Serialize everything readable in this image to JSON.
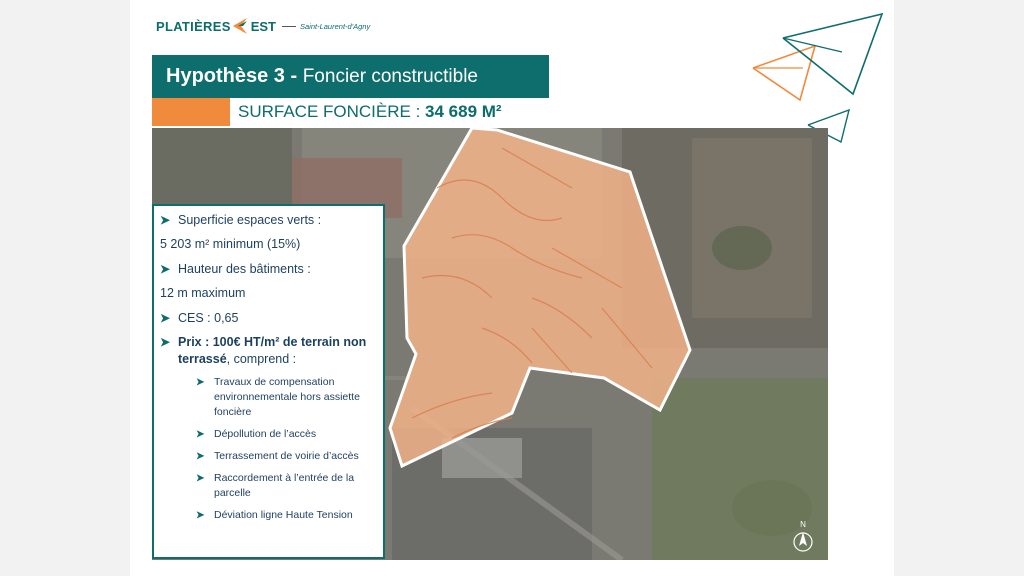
{
  "logo": {
    "brand": "PLATIÈRES",
    "brand_est": "EST",
    "location": "Saint-Laurent-d'Agny"
  },
  "header": {
    "title_strong": "Hypothèse 3 - ",
    "title_rest": "Foncier constructible"
  },
  "surface": {
    "label": "SURFACE FONCIÈRE : ",
    "value": "34 689 M²"
  },
  "info": {
    "item1_label": "Superficie espaces verts :",
    "item1_value": "5 203 m² minimum (15%)",
    "item2_label": "Hauteur des bâtiments :",
    "item2_value": "12 m maximum",
    "item3_label": "CES : 0,65",
    "prix_bold": "Prix : 100€ HT/m² de terrain non terrassé",
    "prix_rest": ", comprend :",
    "subitems": [
      "Travaux de compensation environnementale hors assiette foncière",
      "Dépollution de l’accès",
      "Terrassement de voirie d’accès",
      "Raccordement à l’entrée de la parcelle",
      "Déviation ligne Haute Tension"
    ]
  },
  "map": {
    "north_label": "N"
  },
  "colors": {
    "teal": "#0e6d6d",
    "orange": "#f08a3c",
    "parcel_fill": "#f6b48a"
  }
}
